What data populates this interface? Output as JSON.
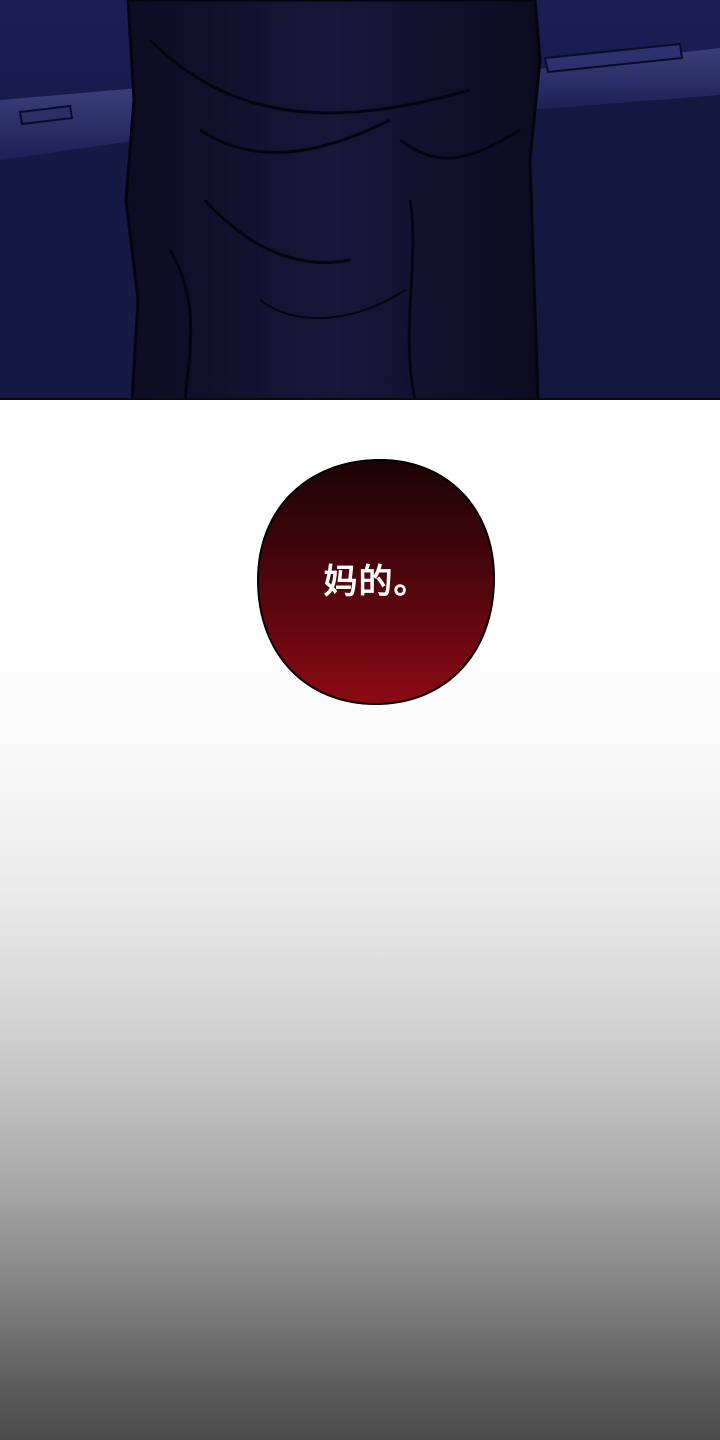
{
  "panels": [
    {
      "id": "top-panel",
      "scene": "dark-night-scene",
      "colors": {
        "background": "#14173f",
        "figure": "#10102a"
      }
    },
    {
      "id": "dialogue-panel",
      "bubble": {
        "text": "妈的。",
        "colors": {
          "top": "#1a0306",
          "bottom": "#8c0a14",
          "outline": "#000000",
          "text": "#ffffff"
        }
      }
    }
  ]
}
